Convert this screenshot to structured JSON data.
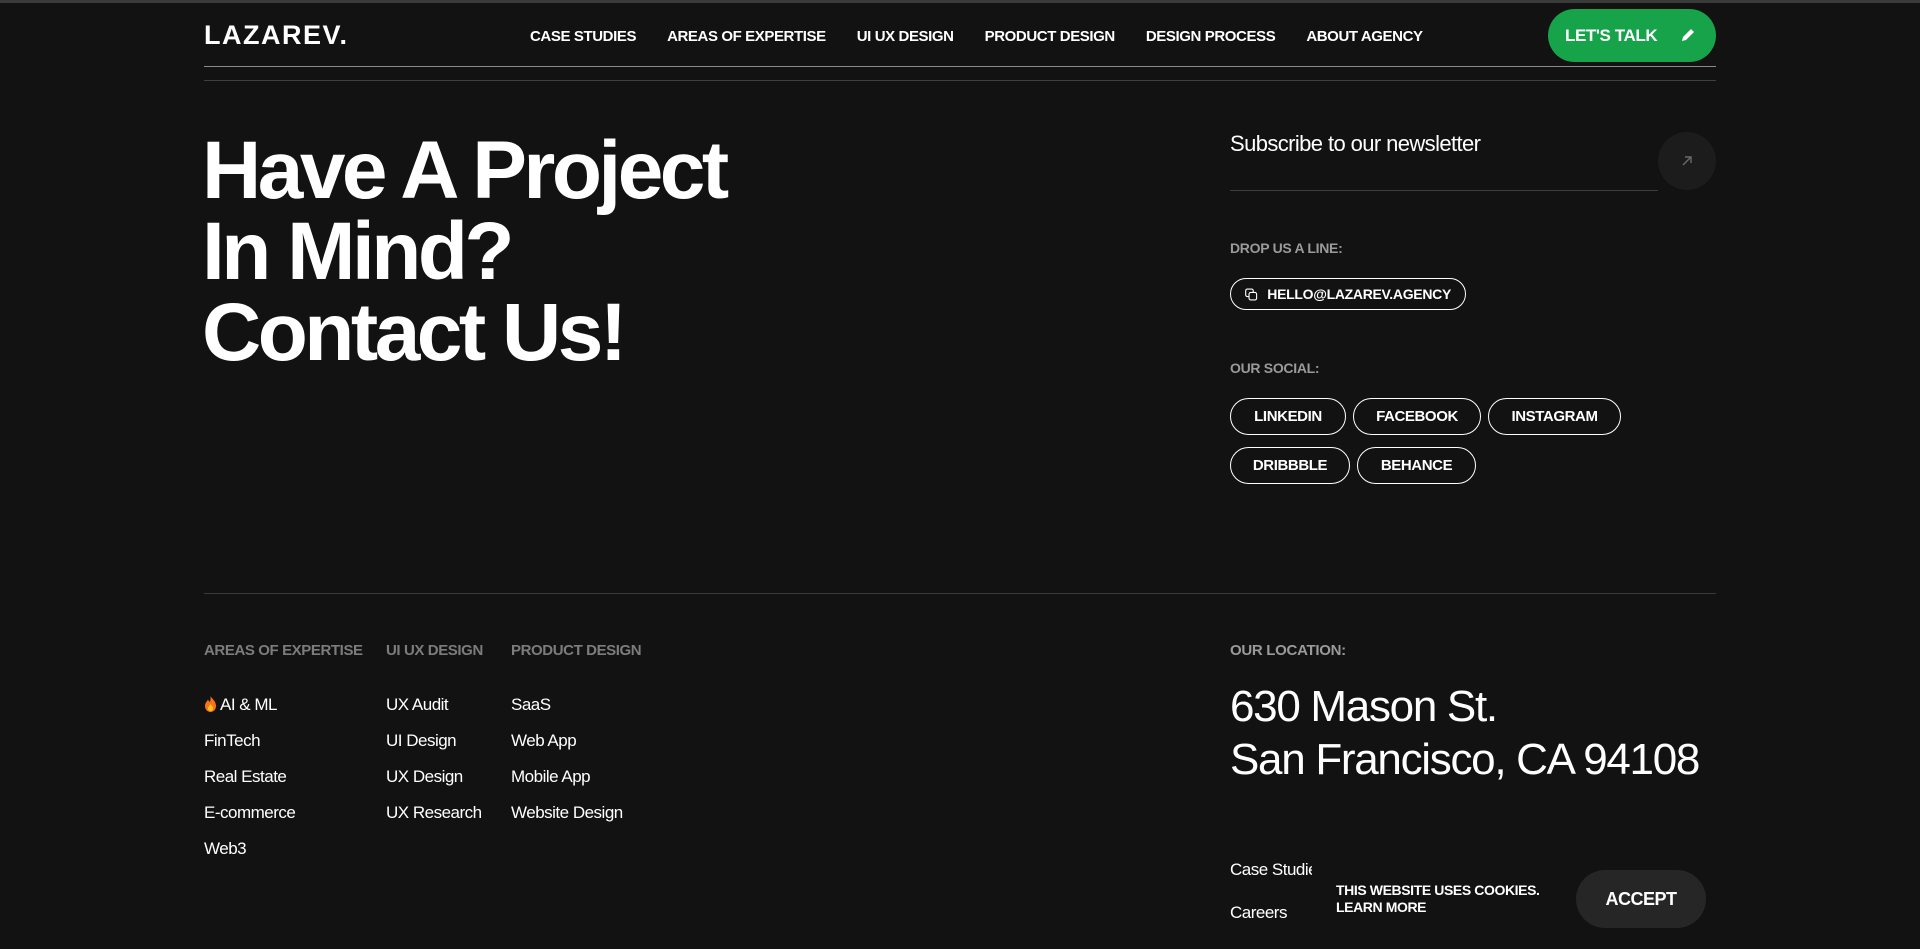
{
  "header": {
    "logo": "LAZAREV.",
    "nav": [
      "CASE STUDIES",
      "AREAS OF EXPERTISE",
      "UI UX DESIGN",
      "PRODUCT DESIGN",
      "DESIGN PROCESS",
      "ABOUT AGENCY"
    ],
    "cta_label": "LET'S TALK",
    "cta_icon": "pencil-icon",
    "accent_color": "#16a34a"
  },
  "hero": {
    "lines": [
      "Have A Project",
      "In Mind?",
      "Contact Us!"
    ]
  },
  "newsletter": {
    "label": "Subscribe to our newsletter",
    "submit_icon": "arrow-up-right-icon"
  },
  "contact": {
    "drop_line_label": "DROP US A LINE:",
    "email": "HELLO@LAZAREV.AGENCY",
    "copy_icon": "copy-icon",
    "social_label": "OUR SOCIAL:",
    "socials": [
      "LINKEDIN",
      "FACEBOOK",
      "INSTAGRAM",
      "DRIBBBLE",
      "BEHANCE"
    ]
  },
  "footer": {
    "columns": [
      {
        "heading": "AREAS OF EXPERTISE",
        "items": [
          "AI & ML",
          "FinTech",
          "Real Estate",
          "E-commerce",
          "Web3"
        ]
      },
      {
        "heading": "UI UX DESIGN",
        "items": [
          "UX Audit",
          "UI Design",
          "UX Design",
          "UX Research"
        ]
      },
      {
        "heading": "PRODUCT DESIGN",
        "items": [
          "SaaS",
          "Web App",
          "Mobile App",
          "Website Design"
        ]
      }
    ],
    "location_label": "OUR LOCATION:",
    "address": [
      "630 Mason St.",
      "San Francisco, CA 94108"
    ],
    "links": [
      "Case Studies",
      "Careers"
    ]
  },
  "cookie": {
    "line1": "THIS WEBSITE USES COOKIES.",
    "line2": "LEARN MORE",
    "accept_label": "ACCEPT"
  }
}
